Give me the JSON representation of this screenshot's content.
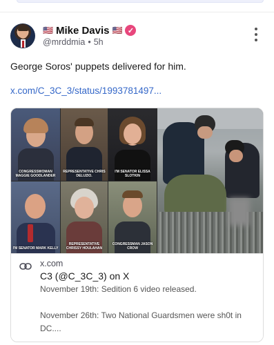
{
  "author": {
    "flag_left": "🇺🇸",
    "name": "Mike Davis",
    "flag_right": "🇺🇸",
    "verified_glyph": "✓",
    "handle": "@mrddmia",
    "separator": "•",
    "time": "5h"
  },
  "post": {
    "text": "George Soros' puppets delivered for him.",
    "link": "x.com/C_3C_3/status/1993781497..."
  },
  "card": {
    "domain": "x.com",
    "title": "C3 (@C_3C_3) on X",
    "desc_line1": "November 19th: Sedition 6 video released.",
    "desc_line2": "November 26th: Two National Guardsmen were sh0t in DC....",
    "tile_labels": [
      "CONGRESSWOMAN MAGGIE GOODLANDER",
      "REPRESENTATIVE CHRIS DELUZIO.",
      "I'M SENATOR ELISSA SLOTKIN",
      "I'M SENATOR MARK KELLY",
      "REPRESENTATIVE CHRISSY HOULAHAN",
      "CONGRESSMAN JASON CROW"
    ]
  },
  "icons": {
    "more": "more-vertical-icon",
    "verified": "verified-badge-icon",
    "link": "link-icon"
  },
  "colors": {
    "link": "#3467c8",
    "verified": "#e8467c"
  }
}
